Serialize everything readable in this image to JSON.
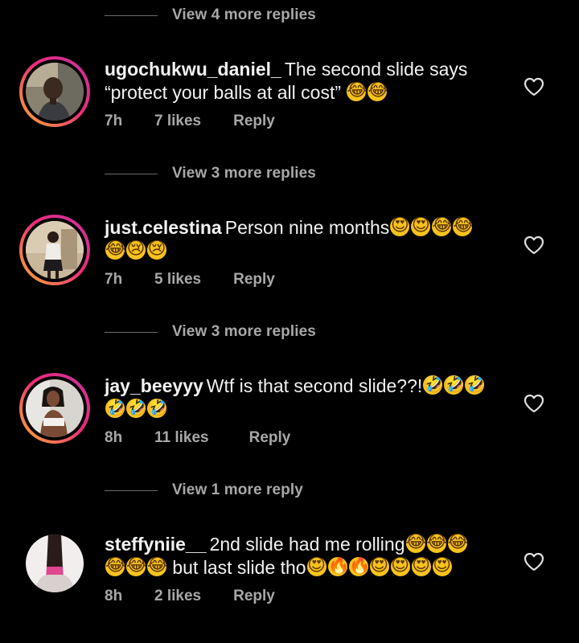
{
  "view_replies": [
    "View 4 more replies",
    "View 3 more replies",
    "View 3 more replies",
    "View 1 more reply"
  ],
  "comments": [
    {
      "username": "ugochukwu_daniel_",
      "text_line1": "The second slide says",
      "text_line2": "“protect your balls at all cost”",
      "emojis_line2": [
        "😂",
        "😂"
      ],
      "time": "7h",
      "likes": "7 likes",
      "reply": "Reply",
      "avatar_icon": "profile-photo-man"
    },
    {
      "username": "just.celestina",
      "text_line1": "Person nine months",
      "emojis_line1": [
        "😍",
        "😍",
        "😂",
        "😂"
      ],
      "emojis_line2": [
        "😂",
        "😢",
        "😢"
      ],
      "time": "7h",
      "likes": "5 likes",
      "reply": "Reply",
      "avatar_icon": "profile-photo-woman-standing"
    },
    {
      "username": "jay_beeyyy",
      "text_line1": "Wtf is that second slide??!",
      "emojis_line1": [
        "🤣",
        "🤣",
        "🤣"
      ],
      "emojis_line2": [
        "🤣",
        "🤣",
        "🤣"
      ],
      "time": "8h",
      "likes": "11 likes",
      "reply": "Reply",
      "avatar_icon": "profile-photo-woman"
    },
    {
      "username": "steffyniie__",
      "text_line1": "2nd slide had me rolling",
      "emojis_line1": [
        "😂",
        "😂",
        "😂"
      ],
      "emojis_line2a": [
        "😂",
        "😂",
        "😂"
      ],
      "text_line2": "but last slide tho",
      "emojis_line2b": [
        "😍",
        "🔥",
        "🔥",
        "😍",
        "😍",
        "😍",
        "😍"
      ],
      "time": "8h",
      "likes": "2 likes",
      "reply": "Reply",
      "avatar_icon": "profile-photo-pink-hair"
    }
  ],
  "colors": {
    "background": "#000000",
    "text": "#f2f2f2",
    "secondary_text": "#a8a8a8",
    "story_ring_start": "#f9b132",
    "story_ring_end": "#c1359f"
  },
  "icons": {
    "like": "heart-outline-icon"
  }
}
